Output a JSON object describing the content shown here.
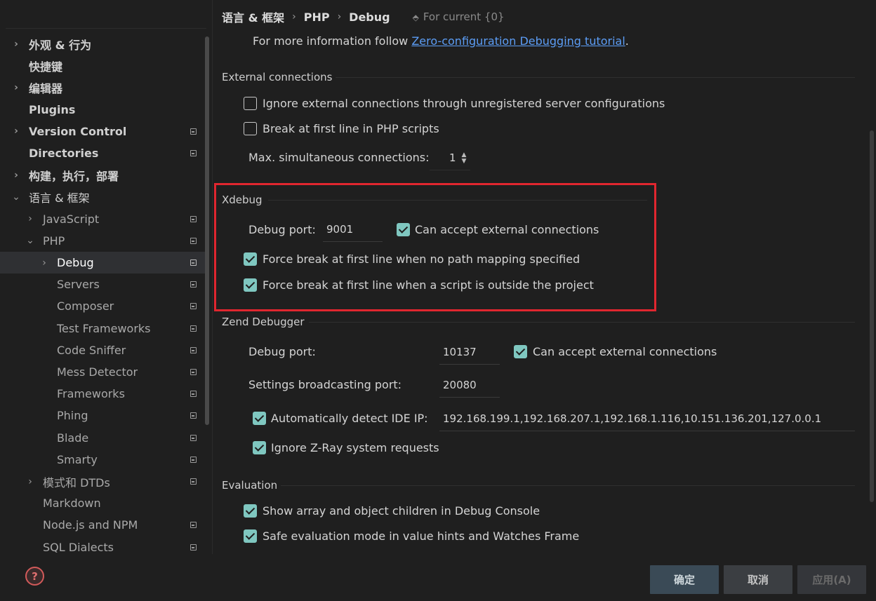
{
  "sidebar": {
    "items": [
      {
        "label": "外观 & 行为",
        "arrow": "›",
        "bold": true
      },
      {
        "label": "快捷键",
        "arrow": "",
        "bold": true
      },
      {
        "label": "编辑器",
        "arrow": "›",
        "bold": true
      },
      {
        "label": "Plugins",
        "arrow": "",
        "bold": true
      },
      {
        "label": "Version Control",
        "arrow": "›",
        "bold": true,
        "project": true
      },
      {
        "label": "Directories",
        "arrow": "",
        "bold": true,
        "project": true
      },
      {
        "label": "构建，执行，部署",
        "arrow": "›",
        "bold": true
      },
      {
        "label": "语言 & 框架",
        "arrow": "⌄",
        "bold": false
      },
      {
        "label": "JavaScript",
        "arrow": "›",
        "project": true
      },
      {
        "label": "PHP",
        "arrow": "⌄",
        "project": true
      },
      {
        "label": "Debug",
        "arrow": "›",
        "project": true,
        "selected": true
      },
      {
        "label": "Servers",
        "arrow": "",
        "project": true
      },
      {
        "label": "Composer",
        "arrow": "",
        "project": true
      },
      {
        "label": "Test Frameworks",
        "arrow": "",
        "project": true
      },
      {
        "label": "Code Sniffer",
        "arrow": "",
        "project": true
      },
      {
        "label": "Mess Detector",
        "arrow": "",
        "project": true
      },
      {
        "label": "Frameworks",
        "arrow": "",
        "project": true
      },
      {
        "label": "Phing",
        "arrow": "",
        "project": true
      },
      {
        "label": "Blade",
        "arrow": "",
        "project": true
      },
      {
        "label": "Smarty",
        "arrow": "",
        "project": true
      },
      {
        "label": "模式和 DTDs",
        "arrow": "›",
        "project": true
      },
      {
        "label": "Markdown",
        "arrow": ""
      },
      {
        "label": "Node.js and NPM",
        "arrow": "",
        "project": true
      },
      {
        "label": "SQL Dialects",
        "arrow": "",
        "project": true
      }
    ]
  },
  "breadcrumb": {
    "parts": [
      "语言 & 框架",
      "PHP",
      "Debug"
    ],
    "separator": "›",
    "scope": "For current {0}"
  },
  "info": {
    "prefix": "For more information follow ",
    "link": "Zero-configuration Debugging tutorial",
    "suffix": "."
  },
  "external": {
    "title": "External connections",
    "ignore_label": "Ignore external connections through unregistered server configurations",
    "ignore_checked": false,
    "break_label": "Break at first line in PHP scripts",
    "break_checked": false,
    "max_label": "Max. simultaneous connections:",
    "max_value": "1"
  },
  "xdebug": {
    "title": "Xdebug",
    "port_label": "Debug port:",
    "port_value": "9001",
    "accept_label": "Can accept external connections",
    "accept_checked": true,
    "force_nomap_label": "Force break at first line when no path mapping specified",
    "force_nomap_checked": true,
    "force_outside_label": "Force break at first line when a script is outside the project",
    "force_outside_checked": true
  },
  "zend": {
    "title": "Zend Debugger",
    "port_label": "Debug port:",
    "port_value": "10137",
    "accept_label": "Can accept external connections",
    "accept_checked": true,
    "broadcast_label": "Settings broadcasting port:",
    "broadcast_value": "20080",
    "autodetect_label": "Automatically detect IDE IP:",
    "autodetect_checked": true,
    "ip_value": "192.168.199.1,192.168.207.1,192.168.1.116,10.151.136.201,127.0.0.1",
    "zray_label": "Ignore Z-Ray system requests",
    "zray_checked": true
  },
  "evaluation": {
    "title": "Evaluation",
    "show_children_label": "Show array and object children in Debug Console",
    "show_children_checked": true,
    "safe_label": "Safe evaluation mode in value hints and Watches Frame",
    "safe_checked": true
  },
  "footer": {
    "help": "?",
    "ok": "确定",
    "cancel": "取消",
    "apply": "应用(A)"
  },
  "colors": {
    "accent_check": "#7fc7c0",
    "highlight_border": "#e0262f",
    "link": "#5c9df5"
  }
}
